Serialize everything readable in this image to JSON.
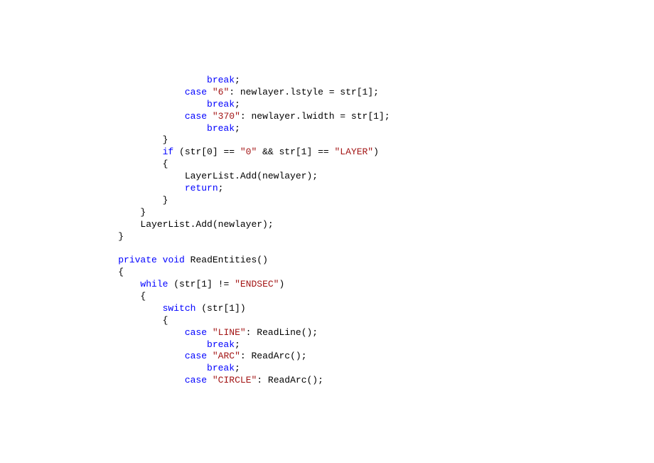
{
  "code": {
    "indent1": "    ",
    "indent2": "        ",
    "indent3": "            ",
    "indent4": "                ",
    "indent5": "                    ",
    "break": "break",
    "case": "case",
    "if": "if",
    "return": "return",
    "private": "private",
    "void": "void",
    "while": "while",
    "switch": "switch",
    "semicolon": ";",
    "colon": ":",
    "openBrace": "{",
    "closeBrace": "}",
    "openParen": "(",
    "closeParen": ")",
    "str6": "\"6\"",
    "str370": "\"370\"",
    "str0": "\"0\"",
    "strLAYER": "\"LAYER\"",
    "strENDSEC": "\"ENDSEC\"",
    "strLINE": "\"LINE\"",
    "strARC": "\"ARC\"",
    "strCIRCLE": "\"CIRCLE\"",
    "line_lstyle": " newlayer.lstyle = str[1];",
    "line_lwidth": " newlayer.lwidth = str[1];",
    "line_ifcond_mid": " (str[0] == ",
    "line_ifcond_and": " && str[1] == ",
    "line_layerlistadd": "LayerList.Add(newlayer);",
    "line_readentities": " ReadEntities()",
    "line_whilecond_pre": " (str[1] != ",
    "line_switchexpr": " (str[1])",
    "line_readline": " ReadLine();",
    "line_readarc": " ReadArc();"
  }
}
